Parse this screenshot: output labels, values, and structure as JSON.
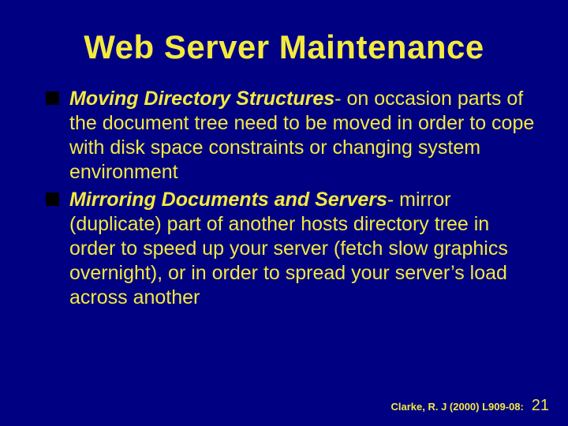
{
  "title": "Web Server Maintenance",
  "bullets": [
    {
      "lead": "Moving Directory Structures",
      "rest": "- on occasion parts of the document tree need to be moved in order to cope with disk space constraints or changing system environment"
    },
    {
      "lead": "Mirroring Documents and Servers",
      "rest": "- mirror (duplicate) part of another hosts directory tree in order to speed up your server (fetch slow graphics overnight), or in order to spread your server’s load across another"
    }
  ],
  "footer": {
    "citation": "Clarke, R. J (2000) L909-08:",
    "page": "21"
  }
}
